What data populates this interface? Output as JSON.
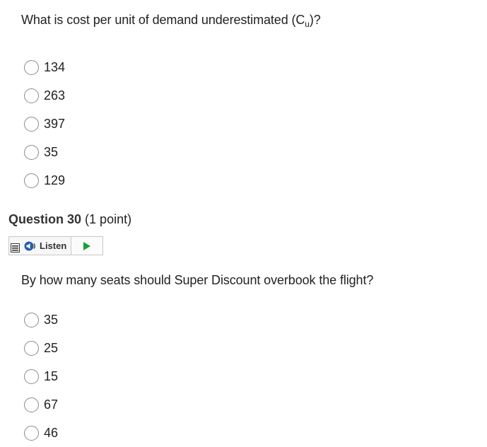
{
  "question29": {
    "text_before": "What is cost per unit of demand underestimated (C",
    "subscript": "u",
    "text_after": ")?",
    "options": [
      "134",
      "263",
      "397",
      "35",
      "129"
    ]
  },
  "question30": {
    "number_label": "Question 30",
    "points_label": "(1 point)",
    "listen_label": "Listen",
    "text": "By how many seats should Super Discount overbook the flight?",
    "options": [
      "35",
      "25",
      "15",
      "67",
      "46"
    ]
  }
}
